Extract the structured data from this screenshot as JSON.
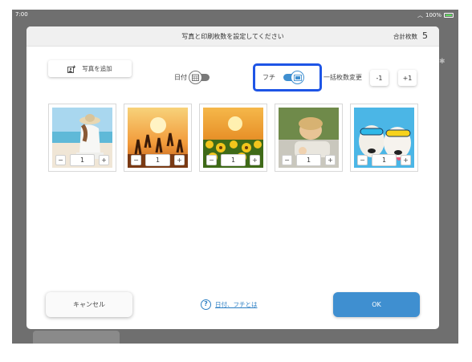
{
  "statusbar": {
    "time": "7:00",
    "battery": "100%"
  },
  "modal": {
    "title": "写真と印刷枚数を設定してください",
    "total_label": "合計枚数",
    "total_value": "5"
  },
  "toolbar": {
    "add_photo_label": "写真を追加",
    "date_label": "日付",
    "date_toggle_on": false,
    "border_label": "フチ",
    "border_toggle_on": true,
    "bulk_label": "一括枚数変更",
    "minus_one_label": "-1",
    "plus_one_label": "+1"
  },
  "photos": [
    {
      "name": "beach-woman",
      "count": "1",
      "minus": "−",
      "plus": "+"
    },
    {
      "name": "sunset-jump",
      "count": "1",
      "minus": "−",
      "plus": "+"
    },
    {
      "name": "sunflowers",
      "count": "1",
      "minus": "−",
      "plus": "+"
    },
    {
      "name": "child",
      "count": "1",
      "minus": "−",
      "plus": "+"
    },
    {
      "name": "dogs-sunglasses",
      "count": "1",
      "minus": "−",
      "plus": "+"
    }
  ],
  "footer": {
    "cancel_label": "キャンセル",
    "help_icon": "?",
    "help_label": "日付、フチとは",
    "ok_label": "OK"
  },
  "colors": {
    "accent": "#3f8fd0",
    "highlight": "#1e55e6",
    "toggle_on": "#3f8fd0",
    "toggle_off": "#7a7a7a"
  }
}
